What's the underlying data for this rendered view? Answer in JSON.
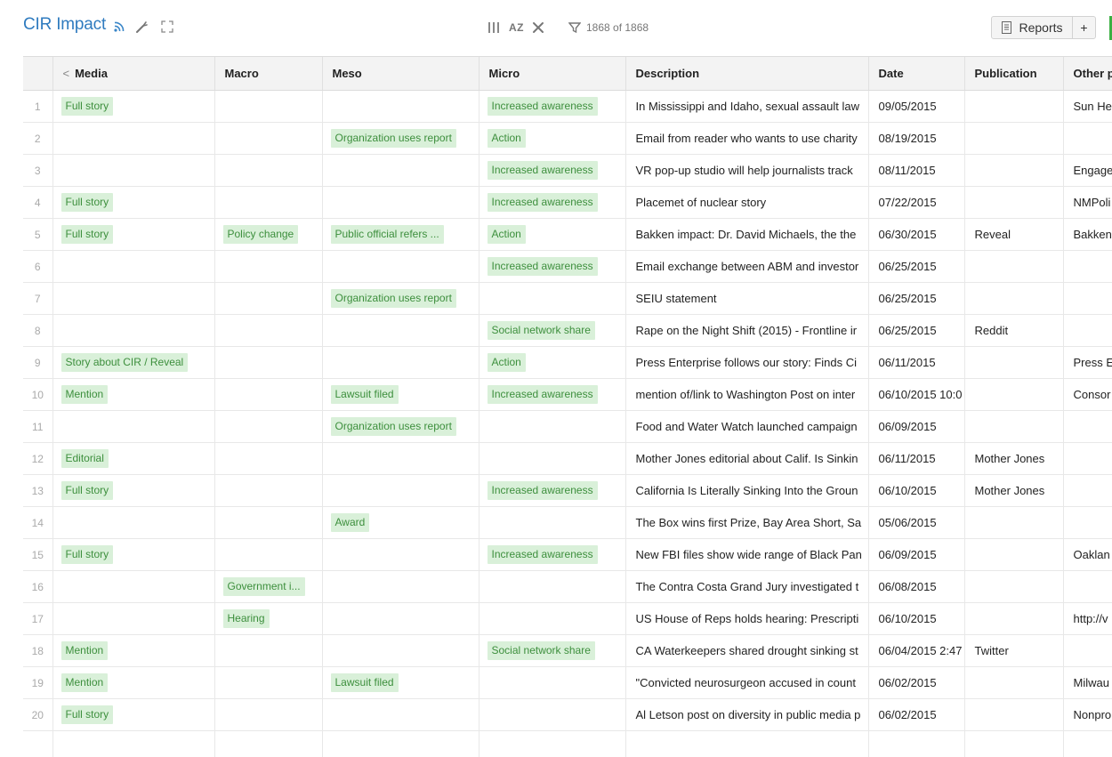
{
  "app": {
    "title": "CIR Impact"
  },
  "toolbar": {
    "sort_label": "AZ",
    "filter_count": "1868 of 1868",
    "reports_label": "Reports",
    "add_label": "+"
  },
  "columns": [
    "Media",
    "Macro",
    "Meso",
    "Micro",
    "Description",
    "Date",
    "Publication",
    "Other p"
  ],
  "rows": [
    {
      "n": "1",
      "media": "Full story",
      "macro": "",
      "meso": "",
      "micro": "Increased awareness",
      "desc": "In Mississippi and Idaho, sexual assault law",
      "date": "09/05/2015",
      "pub": "",
      "other": "Sun He"
    },
    {
      "n": "2",
      "media": "",
      "macro": "",
      "meso": "Organization uses report",
      "micro": "Action",
      "desc": "Email from reader who wants to use charity",
      "date": "08/19/2015",
      "pub": "",
      "other": ""
    },
    {
      "n": "3",
      "media": "",
      "macro": "",
      "meso": "",
      "micro": "Increased awareness",
      "desc": "VR pop-up studio will help journalists track",
      "date": "08/11/2015",
      "pub": "",
      "other": "Engage"
    },
    {
      "n": "4",
      "media": "Full story",
      "macro": "",
      "meso": "",
      "micro": "Increased awareness",
      "desc": "Placemet of nuclear story",
      "date": "07/22/2015",
      "pub": "",
      "other": "NMPoli"
    },
    {
      "n": "5",
      "media": "Full story",
      "macro": "Policy change",
      "meso": "Public official refers ...",
      "micro": "Action",
      "desc": "Bakken impact: Dr. David Michaels, the the",
      "date": "06/30/2015",
      "pub": "Reveal",
      "other": "Bakken"
    },
    {
      "n": "6",
      "media": "",
      "macro": "",
      "meso": "",
      "micro": "Increased awareness",
      "desc": "Email exchange between ABM and investor",
      "date": "06/25/2015",
      "pub": "",
      "other": ""
    },
    {
      "n": "7",
      "media": "",
      "macro": "",
      "meso": "Organization uses report",
      "micro": "",
      "desc": "SEIU statement",
      "date": "06/25/2015",
      "pub": "",
      "other": ""
    },
    {
      "n": "8",
      "media": "",
      "macro": "",
      "meso": "",
      "micro": "Social network share",
      "desc": "Rape on the Night Shift (2015) - Frontline ir",
      "date": "06/25/2015",
      "pub": "Reddit",
      "other": ""
    },
    {
      "n": "9",
      "media": "Story about CIR / Reveal",
      "macro": "",
      "meso": "",
      "micro": "Action",
      "desc": "Press Enterprise follows our story: Finds Ci",
      "date": "06/11/2015",
      "pub": "",
      "other": "Press E"
    },
    {
      "n": "10",
      "media": "Mention",
      "macro": "",
      "meso": "Lawsuit filed",
      "micro": "Increased awareness",
      "desc": "mention of/link to Washington Post on inter",
      "date": "06/10/2015 10:0",
      "pub": "",
      "other": "Consor"
    },
    {
      "n": "11",
      "media": "",
      "macro": "",
      "meso": "Organization uses report",
      "micro": "",
      "desc": "Food and Water Watch launched campaign",
      "date": "06/09/2015",
      "pub": "",
      "other": ""
    },
    {
      "n": "12",
      "media": "Editorial",
      "macro": "",
      "meso": "",
      "micro": "",
      "desc": "Mother Jones editorial about Calif. Is Sinkin",
      "date": "06/11/2015",
      "pub": "Mother Jones",
      "other": ""
    },
    {
      "n": "13",
      "media": "Full story",
      "macro": "",
      "meso": "",
      "micro": "Increased awareness",
      "desc": "California Is Literally Sinking Into the Groun",
      "date": "06/10/2015",
      "pub": "Mother Jones",
      "other": ""
    },
    {
      "n": "14",
      "media": "",
      "macro": "",
      "meso": "Award",
      "micro": "",
      "desc": "The Box wins first Prize, Bay Area Short, Sa",
      "date": "05/06/2015",
      "pub": "",
      "other": ""
    },
    {
      "n": "15",
      "media": "Full story",
      "macro": "",
      "meso": "",
      "micro": "Increased awareness",
      "desc": "New FBI files show wide range of Black Pan",
      "date": "06/09/2015",
      "pub": "",
      "other": "Oaklan"
    },
    {
      "n": "16",
      "media": "",
      "macro": "Government i...",
      "meso": "",
      "micro": "",
      "desc": "The Contra Costa Grand Jury investigated t",
      "date": "06/08/2015",
      "pub": "",
      "other": ""
    },
    {
      "n": "17",
      "media": "",
      "macro": "Hearing",
      "meso": "",
      "micro": "",
      "desc": "US House of Reps holds hearing: Prescripti",
      "date": "06/10/2015",
      "pub": "",
      "other": "http://v"
    },
    {
      "n": "18",
      "media": "Mention",
      "macro": "",
      "meso": "",
      "micro": "Social network share",
      "desc": "CA Waterkeepers shared drought sinking st",
      "date": "06/04/2015 2:47",
      "pub": "Twitter",
      "other": ""
    },
    {
      "n": "19",
      "media": "Mention",
      "macro": "",
      "meso": "Lawsuit filed",
      "micro": "",
      "desc": "\"Convicted neurosurgeon accused in count",
      "date": "06/02/2015",
      "pub": "",
      "other": "Milwau"
    },
    {
      "n": "20",
      "media": "Full story",
      "macro": "",
      "meso": "",
      "micro": "",
      "desc": "Al Letson post on diversity in public media p",
      "date": "06/02/2015",
      "pub": "",
      "other": "Nonpro"
    },
    {
      "n": "",
      "media": "",
      "macro": "",
      "meso": "",
      "micro": "",
      "desc": "",
      "date": "",
      "pub": "",
      "other": ""
    }
  ]
}
